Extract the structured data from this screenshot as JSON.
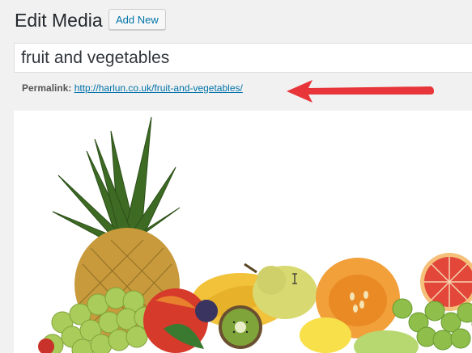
{
  "header": {
    "title": "Edit Media",
    "add_new_label": "Add New"
  },
  "title_field": {
    "value": "fruit and vegetables"
  },
  "permalink": {
    "label": "Permalink:",
    "url": "http://harlun.co.uk/fruit-and-vegetables/"
  },
  "colors": {
    "link": "#0073aa",
    "annotation_arrow": "#e8353a",
    "background": "#f1f1f1"
  },
  "icons": [
    "red-annotation-arrow",
    "text-cursor-icon"
  ]
}
